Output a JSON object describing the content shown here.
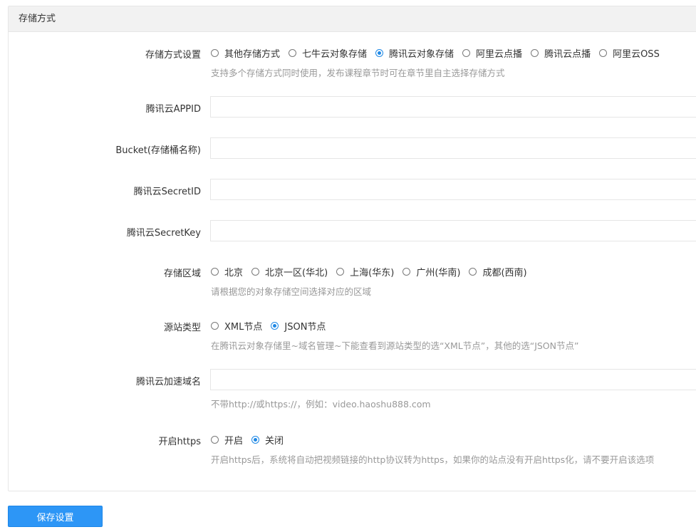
{
  "panel": {
    "title": "存储方式"
  },
  "storage_method": {
    "label": "存储方式设置",
    "options": [
      "其他存储方式",
      "七牛云对象存储",
      "腾讯云对象存储",
      "阿里云点播",
      "腾讯云点播",
      "阿里云OSS"
    ],
    "selected": "腾讯云对象存储",
    "hint": "支持多个存储方式同时使用，发布课程章节时可在章节里自主选择存储方式"
  },
  "appid": {
    "label": "腾讯云APPID",
    "value": ""
  },
  "bucket": {
    "label": "Bucket(存储桶名称)",
    "value": ""
  },
  "secret_id": {
    "label": "腾讯云SecretID",
    "value": ""
  },
  "secret_key": {
    "label": "腾讯云SecretKey",
    "value": ""
  },
  "region": {
    "label": "存储区域",
    "options": [
      "北京",
      "北京一区(华北)",
      "上海(华东)",
      "广州(华南)",
      "成都(西南)"
    ],
    "selected": "",
    "hint": "请根据您的对象存储空间选择对应的区域"
  },
  "origin_type": {
    "label": "源站类型",
    "options": [
      "XML节点",
      "JSON节点"
    ],
    "selected": "JSON节点",
    "hint": "在腾讯云对象存储里~域名管理~下能查看到源站类型的选“XML节点”，其他的选“JSON节点”"
  },
  "cdn_domain": {
    "label": "腾讯云加速域名",
    "value": "",
    "hint": "不带http://或https://，例如：video.haoshu888.com"
  },
  "https": {
    "label": "开启https",
    "options": [
      "开启",
      "关闭"
    ],
    "selected": "关闭",
    "hint": "开启https后，系统将自动把视频链接的http协议转为https，如果你的站点没有开启https化，请不要开启该选项"
  },
  "save_button": {
    "label": "保存设置"
  },
  "colors": {
    "accent": "#2d96f6",
    "radio_checked": "#1e88e5",
    "hint": "#999999",
    "border": "#e6e6e6",
    "header_bg": "#f2f2f2"
  }
}
